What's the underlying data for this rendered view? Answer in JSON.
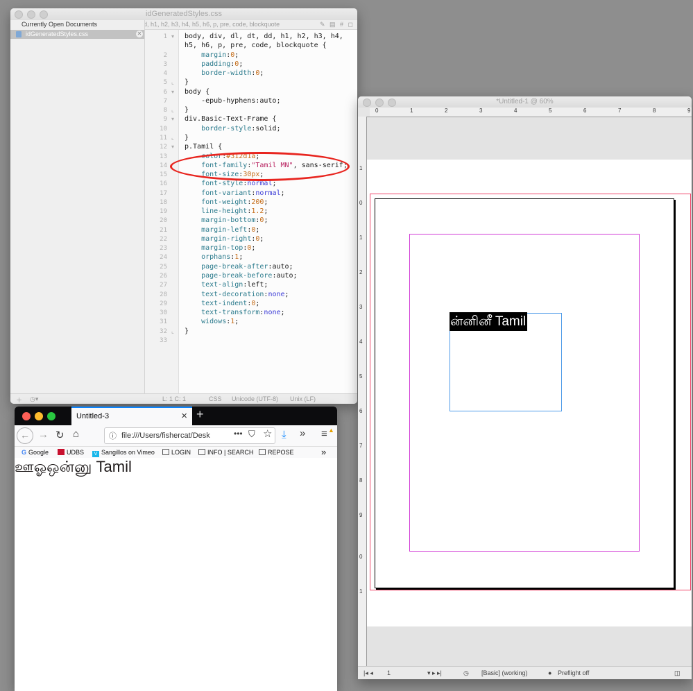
{
  "editor": {
    "title": "idGeneratedStyles.css",
    "sidebar_header": "Currently Open Documents",
    "open_file": "idGeneratedStyles.css",
    "selector_menu": "d, h1, h2, h3, h4, h5, h6, p, pre, code, blockquote",
    "status": {
      "position": "L: 1 C: 1",
      "language": "CSS",
      "encoding": "Unicode (UTF-8)",
      "line_endings": "Unix (LF)"
    },
    "lines": [
      {
        "n": "1",
        "html": "body, div, dl, dt, dd, h1, h2, h3, h4,"
      },
      {
        "n": "",
        "html": "h5, h6, p, pre, code, blockquote {"
      },
      {
        "n": "2",
        "html": "    <span class='p'>margin</span>:<span class='v'>0</span>;"
      },
      {
        "n": "3",
        "html": "    <span class='p'>padding</span>:<span class='v'>0</span>;"
      },
      {
        "n": "4",
        "html": "    <span class='p'>border-width</span>:<span class='v'>0</span>;"
      },
      {
        "n": "5",
        "html": "}"
      },
      {
        "n": "6",
        "html": "body {"
      },
      {
        "n": "7",
        "html": "    -epub-hyphens:auto;"
      },
      {
        "n": "8",
        "html": "}"
      },
      {
        "n": "9",
        "html": "div.Basic-Text-Frame {"
      },
      {
        "n": "10",
        "html": "    <span class='p'>border-style</span>:solid;"
      },
      {
        "n": "11",
        "html": "}"
      },
      {
        "n": "12",
        "html": "p.Tamil {"
      },
      {
        "n": "13",
        "html": "    <span class='p'>color</span>:<span class='v'>#312d1a</span>;"
      },
      {
        "n": "14",
        "html": "    <span class='p'>font-family</span>:<span class='s'>\"Tamil MN\"</span>, sans-serif;"
      },
      {
        "n": "15",
        "html": "    <span class='p'>font-size</span>:<span class='v'>30px</span>;"
      },
      {
        "n": "16",
        "html": "    <span class='p'>font-style</span>:<span class='k'>normal</span>;"
      },
      {
        "n": "17",
        "html": "    <span class='p'>font-variant</span>:<span class='k'>normal</span>;"
      },
      {
        "n": "18",
        "html": "    <span class='p'>font-weight</span>:<span class='v'>200</span>;"
      },
      {
        "n": "19",
        "html": "    <span class='p'>line-height</span>:<span class='v'>1.2</span>;"
      },
      {
        "n": "20",
        "html": "    <span class='p'>margin-bottom</span>:<span class='v'>0</span>;"
      },
      {
        "n": "21",
        "html": "    <span class='p'>margin-left</span>:<span class='v'>0</span>;"
      },
      {
        "n": "22",
        "html": "    <span class='p'>margin-right</span>:<span class='v'>0</span>;"
      },
      {
        "n": "23",
        "html": "    <span class='p'>margin-top</span>:<span class='v'>0</span>;"
      },
      {
        "n": "24",
        "html": "    <span class='p'>orphans</span>:<span class='v'>1</span>;"
      },
      {
        "n": "25",
        "html": "    <span class='p'>page-break-after</span>:auto;"
      },
      {
        "n": "26",
        "html": "    <span class='p'>page-break-before</span>:auto;"
      },
      {
        "n": "27",
        "html": "    <span class='p'>text-align</span>:left;"
      },
      {
        "n": "28",
        "html": "    <span class='p'>text-decoration</span>:<span class='k'>none</span>;"
      },
      {
        "n": "29",
        "html": "    <span class='p'>text-indent</span>:<span class='v'>0</span>;"
      },
      {
        "n": "30",
        "html": "    <span class='p'>text-transform</span>:<span class='k'>none</span>;"
      },
      {
        "n": "31",
        "html": "    <span class='p'>widows</span>:<span class='v'>1</span>;"
      },
      {
        "n": "32",
        "html": "}"
      },
      {
        "n": "33",
        "html": ""
      }
    ]
  },
  "browser": {
    "tab_title": "Untitled-3",
    "url": "file:///Users/fishercat/Desk",
    "bookmarks": [
      "Google",
      "UDBS",
      "Sangillos on Vimeo",
      "LOGIN",
      "INFO | SEARCH",
      "REPOSE"
    ],
    "rendered_text": "ஊஓஒன்னு Tamil"
  },
  "indesign": {
    "title": "*Untitled-1 @ 60%",
    "frame_text": "ன்னினீ Tamil",
    "status": {
      "page": "1",
      "style": "[Basic] (working)",
      "preflight": "Preflight off"
    }
  },
  "colors": {
    "annotation_ring": "#e8251f",
    "bleed_guide": "#f0466a",
    "margin_guide": "#d13ad6",
    "frame_edge": "#4d9ae8",
    "firefox_accent": "#0a84ff"
  }
}
